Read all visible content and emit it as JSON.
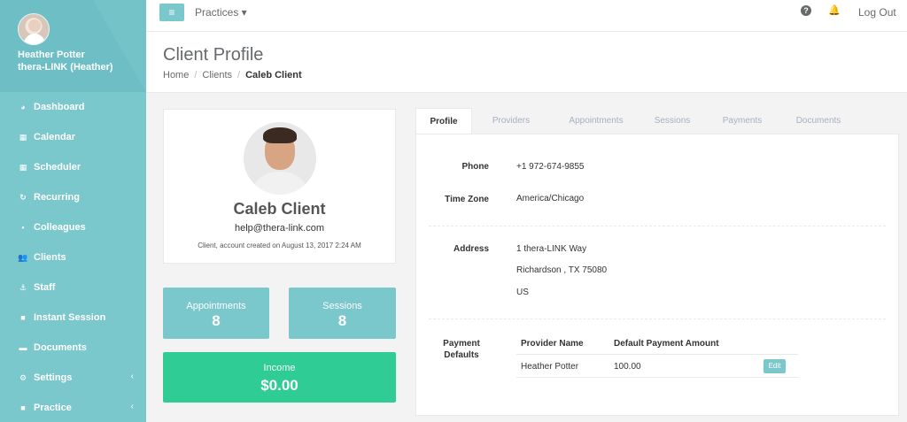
{
  "user": {
    "name": "Heather Potter",
    "org": "thera-LINK (Heather)"
  },
  "nav": [
    {
      "label": "Dashboard",
      "icon": "palette-icon",
      "glyph": "◕"
    },
    {
      "label": "Calendar",
      "icon": "calendar-icon",
      "glyph": "▦"
    },
    {
      "label": "Scheduler",
      "icon": "calendar-icon",
      "glyph": "▦"
    },
    {
      "label": "Recurring",
      "icon": "refresh-icon",
      "glyph": "↻"
    },
    {
      "label": "Colleagues",
      "icon": "grid-icon",
      "glyph": "▪"
    },
    {
      "label": "Clients",
      "icon": "users-icon",
      "glyph": "👥"
    },
    {
      "label": "Staff",
      "icon": "anchor-icon",
      "glyph": "⚓"
    },
    {
      "label": "Instant Session",
      "icon": "video-icon",
      "glyph": "■"
    },
    {
      "label": "Documents",
      "icon": "folder-icon",
      "glyph": "▬"
    },
    {
      "label": "Settings",
      "icon": "gear-icon",
      "glyph": "⚙"
    },
    {
      "label": "Practice",
      "icon": "square-icon",
      "glyph": "■"
    }
  ],
  "topbar": {
    "menu_glyph": "≡",
    "practices": "Practices ▾",
    "help_glyph": "?",
    "bell_glyph": "🔔",
    "logout": "Log Out"
  },
  "header": {
    "title": "Client Profile",
    "breadcrumb": [
      "Home",
      "Clients",
      "Caleb Client"
    ]
  },
  "client": {
    "name": "Caleb Client",
    "email": "help@thera-link.com",
    "created": "Client, account created on August 13, 2017 2:24 AM"
  },
  "stats": {
    "appointments_label": "Appointments",
    "appointments_value": "8",
    "sessions_label": "Sessions",
    "sessions_value": "8",
    "income_label": "Income",
    "income_value": "$0.00"
  },
  "tabs": [
    "Profile",
    "Providers",
    "Appointments",
    "Sessions",
    "Payments",
    "Documents"
  ],
  "profile": {
    "phone_label": "Phone",
    "phone": "+1 972-674-9855",
    "tz_label": "Time Zone",
    "tz": "America/Chicago",
    "address_label": "Address",
    "address_line1": "1 thera-LINK Way",
    "address_line2": "Richardson , TX 75080",
    "address_line3": "US",
    "pd_label_1": "Payment",
    "pd_label_2": "Defaults",
    "pd_headers": [
      "Provider Name",
      "Default Payment Amount"
    ],
    "pd_rows": [
      {
        "provider": "Heather Potter",
        "amount": "100.00",
        "action": "Edit"
      }
    ]
  },
  "colors": {
    "sidebar": "#7ac7cc",
    "income": "#2fcc95",
    "accent": "#7ac7cc"
  }
}
